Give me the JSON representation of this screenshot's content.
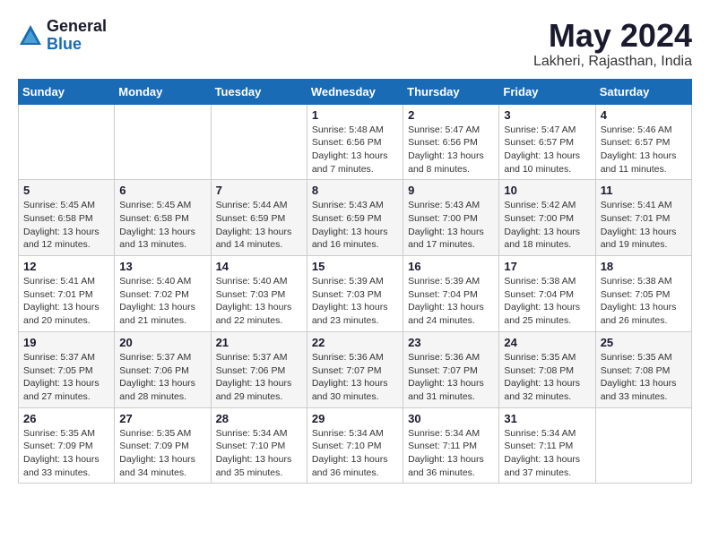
{
  "logo": {
    "general": "General",
    "blue": "Blue"
  },
  "title": "May 2024",
  "location": "Lakheri, Rajasthan, India",
  "days_of_week": [
    "Sunday",
    "Monday",
    "Tuesday",
    "Wednesday",
    "Thursday",
    "Friday",
    "Saturday"
  ],
  "weeks": [
    [
      {
        "day": "",
        "info": ""
      },
      {
        "day": "",
        "info": ""
      },
      {
        "day": "",
        "info": ""
      },
      {
        "day": "1",
        "info": "Sunrise: 5:48 AM\nSunset: 6:56 PM\nDaylight: 13 hours\nand 7 minutes."
      },
      {
        "day": "2",
        "info": "Sunrise: 5:47 AM\nSunset: 6:56 PM\nDaylight: 13 hours\nand 8 minutes."
      },
      {
        "day": "3",
        "info": "Sunrise: 5:47 AM\nSunset: 6:57 PM\nDaylight: 13 hours\nand 10 minutes."
      },
      {
        "day": "4",
        "info": "Sunrise: 5:46 AM\nSunset: 6:57 PM\nDaylight: 13 hours\nand 11 minutes."
      }
    ],
    [
      {
        "day": "5",
        "info": "Sunrise: 5:45 AM\nSunset: 6:58 PM\nDaylight: 13 hours\nand 12 minutes."
      },
      {
        "day": "6",
        "info": "Sunrise: 5:45 AM\nSunset: 6:58 PM\nDaylight: 13 hours\nand 13 minutes."
      },
      {
        "day": "7",
        "info": "Sunrise: 5:44 AM\nSunset: 6:59 PM\nDaylight: 13 hours\nand 14 minutes."
      },
      {
        "day": "8",
        "info": "Sunrise: 5:43 AM\nSunset: 6:59 PM\nDaylight: 13 hours\nand 16 minutes."
      },
      {
        "day": "9",
        "info": "Sunrise: 5:43 AM\nSunset: 7:00 PM\nDaylight: 13 hours\nand 17 minutes."
      },
      {
        "day": "10",
        "info": "Sunrise: 5:42 AM\nSunset: 7:00 PM\nDaylight: 13 hours\nand 18 minutes."
      },
      {
        "day": "11",
        "info": "Sunrise: 5:41 AM\nSunset: 7:01 PM\nDaylight: 13 hours\nand 19 minutes."
      }
    ],
    [
      {
        "day": "12",
        "info": "Sunrise: 5:41 AM\nSunset: 7:01 PM\nDaylight: 13 hours\nand 20 minutes."
      },
      {
        "day": "13",
        "info": "Sunrise: 5:40 AM\nSunset: 7:02 PM\nDaylight: 13 hours\nand 21 minutes."
      },
      {
        "day": "14",
        "info": "Sunrise: 5:40 AM\nSunset: 7:03 PM\nDaylight: 13 hours\nand 22 minutes."
      },
      {
        "day": "15",
        "info": "Sunrise: 5:39 AM\nSunset: 7:03 PM\nDaylight: 13 hours\nand 23 minutes."
      },
      {
        "day": "16",
        "info": "Sunrise: 5:39 AM\nSunset: 7:04 PM\nDaylight: 13 hours\nand 24 minutes."
      },
      {
        "day": "17",
        "info": "Sunrise: 5:38 AM\nSunset: 7:04 PM\nDaylight: 13 hours\nand 25 minutes."
      },
      {
        "day": "18",
        "info": "Sunrise: 5:38 AM\nSunset: 7:05 PM\nDaylight: 13 hours\nand 26 minutes."
      }
    ],
    [
      {
        "day": "19",
        "info": "Sunrise: 5:37 AM\nSunset: 7:05 PM\nDaylight: 13 hours\nand 27 minutes."
      },
      {
        "day": "20",
        "info": "Sunrise: 5:37 AM\nSunset: 7:06 PM\nDaylight: 13 hours\nand 28 minutes."
      },
      {
        "day": "21",
        "info": "Sunrise: 5:37 AM\nSunset: 7:06 PM\nDaylight: 13 hours\nand 29 minutes."
      },
      {
        "day": "22",
        "info": "Sunrise: 5:36 AM\nSunset: 7:07 PM\nDaylight: 13 hours\nand 30 minutes."
      },
      {
        "day": "23",
        "info": "Sunrise: 5:36 AM\nSunset: 7:07 PM\nDaylight: 13 hours\nand 31 minutes."
      },
      {
        "day": "24",
        "info": "Sunrise: 5:35 AM\nSunset: 7:08 PM\nDaylight: 13 hours\nand 32 minutes."
      },
      {
        "day": "25",
        "info": "Sunrise: 5:35 AM\nSunset: 7:08 PM\nDaylight: 13 hours\nand 33 minutes."
      }
    ],
    [
      {
        "day": "26",
        "info": "Sunrise: 5:35 AM\nSunset: 7:09 PM\nDaylight: 13 hours\nand 33 minutes."
      },
      {
        "day": "27",
        "info": "Sunrise: 5:35 AM\nSunset: 7:09 PM\nDaylight: 13 hours\nand 34 minutes."
      },
      {
        "day": "28",
        "info": "Sunrise: 5:34 AM\nSunset: 7:10 PM\nDaylight: 13 hours\nand 35 minutes."
      },
      {
        "day": "29",
        "info": "Sunrise: 5:34 AM\nSunset: 7:10 PM\nDaylight: 13 hours\nand 36 minutes."
      },
      {
        "day": "30",
        "info": "Sunrise: 5:34 AM\nSunset: 7:11 PM\nDaylight: 13 hours\nand 36 minutes."
      },
      {
        "day": "31",
        "info": "Sunrise: 5:34 AM\nSunset: 7:11 PM\nDaylight: 13 hours\nand 37 minutes."
      },
      {
        "day": "",
        "info": ""
      }
    ]
  ]
}
